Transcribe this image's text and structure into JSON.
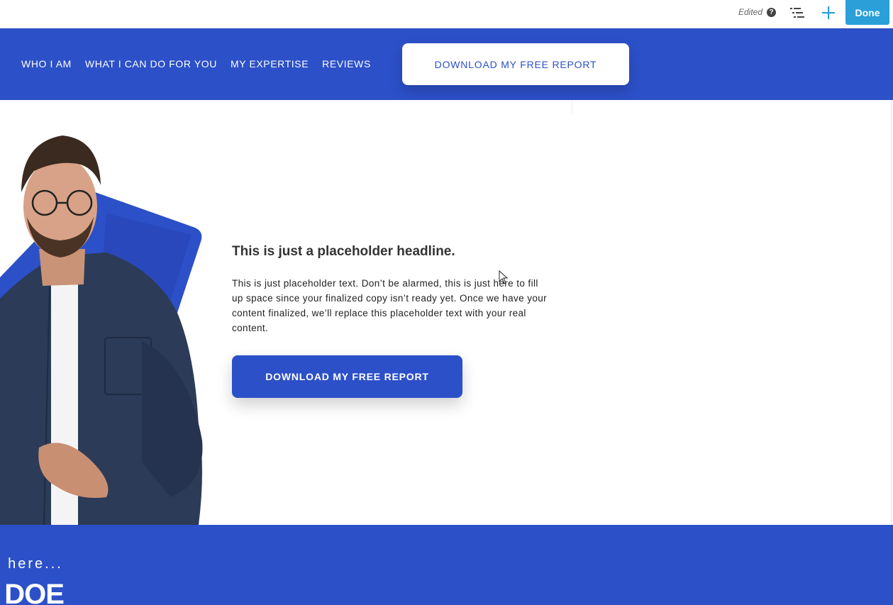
{
  "editor": {
    "status": "Edited",
    "help_glyph": "?",
    "done_label": "Done",
    "icons": [
      "help-icon",
      "outline-list-icon",
      "plus-icon"
    ],
    "accent": "#2a9fd8"
  },
  "nav": {
    "links": [
      "WHO I AM",
      "WHAT I CAN DO FOR YOU",
      "MY EXPERTISE",
      "REVIEWS"
    ],
    "cta": "DOWNLOAD MY FREE REPORT",
    "background": "#2c50c8"
  },
  "hero": {
    "headline": "This is just a placeholder headline.",
    "body": "This is just placeholder text. Don’t be alarmed, this is just here to fill up space since your finalized copy isn’t ready yet. Once we have your content finalized, we’ll replace this placeholder text with your real content.",
    "cta": "DOWNLOAD MY FREE REPORT"
  },
  "bottom": {
    "small": ": here...",
    "big": "I DOE"
  }
}
